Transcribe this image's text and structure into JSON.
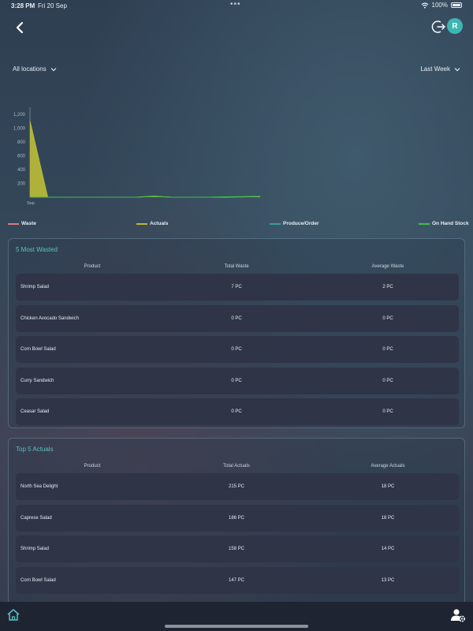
{
  "status_bar": {
    "time": "3:28 PM",
    "date": "Fri 20 Sep",
    "dots": "•••",
    "battery": "100%"
  },
  "header": {
    "avatar_initial": "R"
  },
  "filters": {
    "location": "All locations",
    "period": "Last Week"
  },
  "chart_data": {
    "type": "area",
    "x_tick_labels": [
      "Sep"
    ],
    "y_tick_labels": [
      "200",
      "400",
      "600",
      "800",
      "1,000",
      "1,200"
    ],
    "ylim": [
      0,
      1300
    ],
    "points_count": 14,
    "series": [
      {
        "name": "Actuals",
        "color": "#b5b83a",
        "values": [
          1100,
          0,
          0,
          0,
          0,
          0,
          0,
          15,
          0,
          0,
          0,
          0,
          5,
          10
        ]
      },
      {
        "name": "On Hand Stock",
        "color": "#3fbf4a",
        "values": [
          0,
          0,
          0,
          0,
          0,
          0,
          0,
          10,
          0,
          0,
          0,
          5,
          8,
          12
        ]
      }
    ],
    "legend": [
      {
        "name": "Waste",
        "color": "#d67a82"
      },
      {
        "name": "Actuals",
        "color": "#b5b83a"
      },
      {
        "name": "Produce/Order",
        "color": "#3b9fa3"
      },
      {
        "name": "On Hand Stock",
        "color": "#3fbf4a"
      }
    ]
  },
  "most_wasted": {
    "title": "5 Most Wasted",
    "headers": [
      "Product",
      "Total Waste",
      "Average Waste"
    ],
    "rows": [
      [
        "Shrimp Salad",
        "7 PC",
        "2 PC"
      ],
      [
        "Chicken Avocado Sandwich",
        "0 PC",
        "0 PC"
      ],
      [
        "Corn Bowl Salad",
        "0 PC",
        "0 PC"
      ],
      [
        "Curry Sandwich",
        "0 PC",
        "0 PC"
      ],
      [
        "Ceasar Salad",
        "0 PC",
        "0 PC"
      ]
    ]
  },
  "top_actuals": {
    "title": "Top 5 Actuals",
    "headers": [
      "Product",
      "Total Actuals",
      "Average Actuals"
    ],
    "rows": [
      [
        "North Sea Delight",
        "215 PC",
        "18 PC"
      ],
      [
        "Caprese Salad",
        "186 PC",
        "16 PC"
      ],
      [
        "Shrimp Salad",
        "158 PC",
        "14 PC"
      ],
      [
        "Corn Bowl Salad",
        "147 PC",
        "13 PC"
      ]
    ]
  }
}
